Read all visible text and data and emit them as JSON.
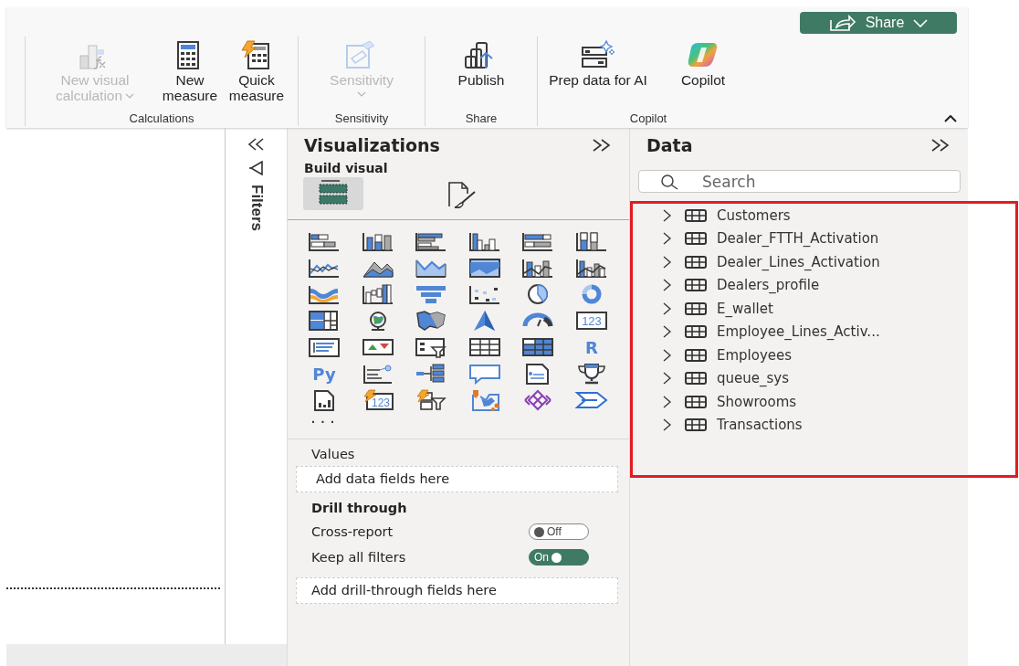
{
  "ribbon": {
    "share_button": {
      "label": "Share"
    },
    "groups": [
      {
        "label": "Calculations",
        "buttons": [
          {
            "kind": "visual-calculation",
            "label": "New visual calculation",
            "disabled": true,
            "dropdown": true
          },
          {
            "kind": "new-measure",
            "label": "New measure",
            "disabled": false,
            "dropdown": false
          },
          {
            "kind": "quick-measure",
            "label": "Quick measure",
            "disabled": false,
            "dropdown": false
          }
        ]
      },
      {
        "label": "Sensitivity",
        "buttons": [
          {
            "kind": "sensitivity",
            "label": "Sensitivity",
            "disabled": true,
            "dropdown": true
          }
        ]
      },
      {
        "label": "Share",
        "buttons": [
          {
            "kind": "publish",
            "label": "Publish",
            "disabled": false,
            "dropdown": false
          }
        ]
      },
      {
        "label": "Copilot",
        "buttons": [
          {
            "kind": "prep-data",
            "label": "Prep data for AI",
            "disabled": false,
            "dropdown": false
          },
          {
            "kind": "copilot",
            "label": "Copilot",
            "disabled": false,
            "dropdown": false
          }
        ]
      }
    ]
  },
  "filters_pane": {
    "title": "Filters"
  },
  "visualizations": {
    "title": "Visualizations",
    "subtitle": "Build visual",
    "tabs": [
      {
        "kind": "build",
        "selected": true
      },
      {
        "kind": "format",
        "selected": false
      }
    ],
    "gallery": [
      {
        "kind": "stacked-bar"
      },
      {
        "kind": "stacked-column"
      },
      {
        "kind": "clustered-bar"
      },
      {
        "kind": "clustered-column"
      },
      {
        "kind": "full-bar"
      },
      {
        "kind": "full-column"
      },
      {
        "kind": "line"
      },
      {
        "kind": "area"
      },
      {
        "kind": "stacked-area"
      },
      {
        "kind": "full-area"
      },
      {
        "kind": "line-stacked-column"
      },
      {
        "kind": "line-clustered-column"
      },
      {
        "kind": "ribbon"
      },
      {
        "kind": "waterfall"
      },
      {
        "kind": "funnel"
      },
      {
        "kind": "scatter"
      },
      {
        "kind": "pie"
      },
      {
        "kind": "donut"
      },
      {
        "kind": "treemap"
      },
      {
        "kind": "globe"
      },
      {
        "kind": "filled-map"
      },
      {
        "kind": "arrow"
      },
      {
        "kind": "gauge"
      },
      {
        "kind": "card",
        "label": "123"
      },
      {
        "kind": "multi-row-card"
      },
      {
        "kind": "kpi"
      },
      {
        "kind": "slicer"
      },
      {
        "kind": "table"
      },
      {
        "kind": "matrix"
      },
      {
        "kind": "letter",
        "label": "R"
      },
      {
        "kind": "letter",
        "label": "Py"
      },
      {
        "kind": "influencers"
      },
      {
        "kind": "tree"
      },
      {
        "kind": "speech"
      },
      {
        "kind": "narrative"
      },
      {
        "kind": "trophy"
      },
      {
        "kind": "report"
      },
      {
        "kind": "bolt-card",
        "label": "123"
      },
      {
        "kind": "bolt-slicer"
      },
      {
        "kind": "pin-map"
      },
      {
        "kind": "diamond"
      },
      {
        "kind": "chevron"
      }
    ],
    "more": "· · ·",
    "values": {
      "label": "Values",
      "drop_zone": "Add data fields here"
    },
    "drill_through": {
      "title": "Drill through",
      "toggles": [
        {
          "label": "Cross-report",
          "on": false,
          "state_text": "Off"
        },
        {
          "label": "Keep all filters",
          "on": true,
          "state_text": "On"
        }
      ],
      "drop_zone": "Add drill-through fields here"
    }
  },
  "data_pane": {
    "title": "Data",
    "search": {
      "placeholder": "Search"
    },
    "tables": [
      {
        "name": "Customers",
        "expanded": false
      },
      {
        "name": "Dealer_FTTH_Activation",
        "expanded": false
      },
      {
        "name": "Dealer_Lines_Activation",
        "expanded": false
      },
      {
        "name": "Dealers_profile",
        "expanded": false
      },
      {
        "name": "E_wallet",
        "expanded": false
      },
      {
        "name": "Employee_Lines_Activ...",
        "expanded": false
      },
      {
        "name": "Employees",
        "expanded": false
      },
      {
        "name": "queue_sys",
        "expanded": false
      },
      {
        "name": "Showrooms",
        "expanded": false
      },
      {
        "name": "Transactions",
        "expanded": false
      }
    ]
  }
}
